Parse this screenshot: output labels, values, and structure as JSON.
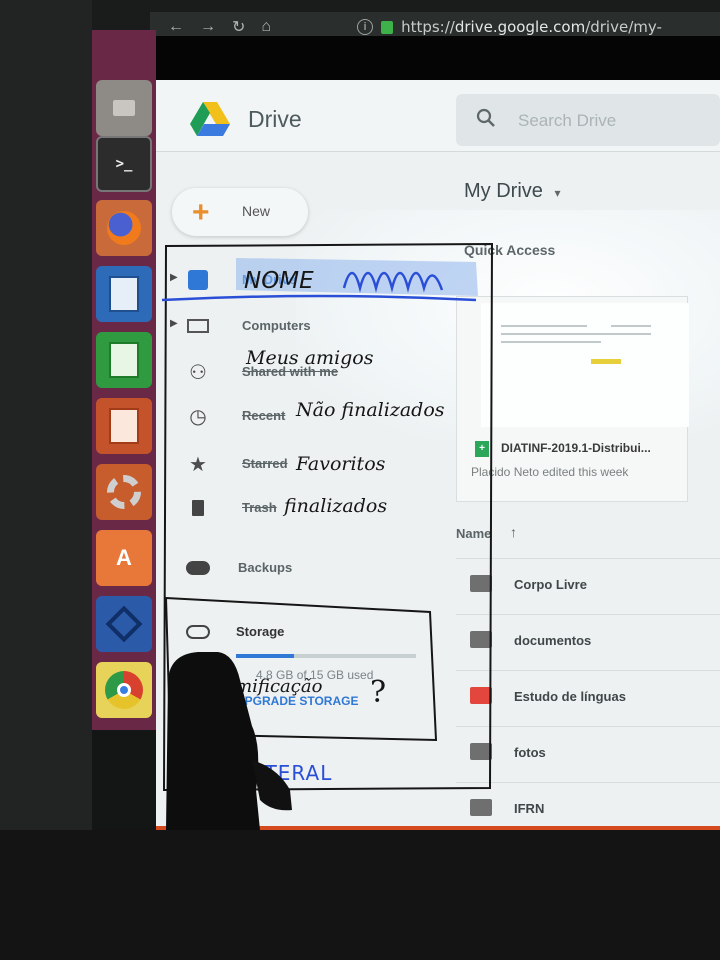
{
  "browser": {
    "nav_icons": [
      "back-icon",
      "forward-icon",
      "reload-icon",
      "home-icon"
    ],
    "info_glyph": "i",
    "url_scheme": "https://",
    "url_host": "drive.google.com",
    "url_path": "/drive/my-"
  },
  "launcher": {
    "items": [
      "files-icon",
      "terminal-icon",
      "firefox-icon",
      "writer-icon",
      "calc-icon",
      "impress-icon",
      "system-settings-icon",
      "software-center-icon",
      "vscode-icon",
      "chrome-icon"
    ],
    "terminal_glyph": ">_"
  },
  "drive": {
    "app_name": "Drive",
    "search_placeholder": "Search Drive",
    "new_label": "New",
    "title": "My Drive",
    "sidebar": {
      "items": [
        {
          "label": "My Drive",
          "icon": "drive-icon"
        },
        {
          "label": "Computers",
          "icon": "computers-icon"
        },
        {
          "label": "Shared with me",
          "icon": "people-icon"
        },
        {
          "label": "Recent",
          "icon": "clock-icon"
        },
        {
          "label": "Starred",
          "icon": "star-icon"
        },
        {
          "label": "Trash",
          "icon": "trash-icon"
        },
        {
          "label": "Backups",
          "icon": "cloud-icon"
        },
        {
          "label": "Storage",
          "icon": "cloud-outline-icon"
        }
      ],
      "storage_used": "4.8 GB of 15 GB used",
      "storage_fraction": 0.32,
      "upgrade_label": "UPGRADE STORAGE"
    },
    "quick_access": {
      "heading": "Quick Access",
      "file_name": "DIATINF-2019.1-Distribui...",
      "file_badge": "+",
      "file_meta": "Placido Neto edited this week"
    },
    "files": {
      "name_header": "Name",
      "sort_arrow": "↑",
      "folders": [
        {
          "name": "Corpo Livre",
          "color": "#6f6f6f"
        },
        {
          "name": "documentos",
          "color": "#6f6f6f"
        },
        {
          "name": "Estudo de línguas",
          "color": "#e2463c"
        },
        {
          "name": "fotos",
          "color": "#6f6f6f"
        },
        {
          "name": "IFRN",
          "color": "#6f6f6f"
        }
      ]
    }
  },
  "annotations": {
    "nome": "NOME",
    "scribble": "mmm",
    "meus_amigos": "Meus amigos",
    "nao_finalizados": "Não finalizados",
    "favoritos": "Favoritos",
    "finalizados": "finalizados",
    "gamificacao": "Gamificação",
    "question_mark": "?",
    "menu_lateral": "MENU LATERAL"
  },
  "colors": {
    "ink_blue": "#2a4fd6",
    "ink_black": "#161616",
    "drive_blue": "#2f78d6",
    "launcher": "#6a2847"
  }
}
